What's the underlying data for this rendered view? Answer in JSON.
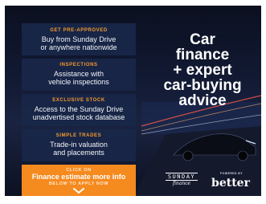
{
  "panels": [
    {
      "kicker": "GET PRE-APPROVED",
      "line1": "Buy from Sunday Drive",
      "line2": "or anywhere nationwide"
    },
    {
      "kicker": "INSPECTIONS",
      "line1": "Assistance with",
      "line2": "vehicle inspections"
    },
    {
      "kicker": "EXCLUSIVE STOCK",
      "line1": "Access to the Sunday Drive",
      "line2": "unadvertised stock database"
    },
    {
      "kicker": "SIMPLE TRADES",
      "line1": "Trade-in valuation",
      "line2": "and placements"
    }
  ],
  "cta": {
    "top": "CLICK ON",
    "main": "Finance estimate more info",
    "bottom": "BELOW TO APPLY NOW"
  },
  "headline": {
    "l1": "Car",
    "l2": "finance",
    "l3": "+ expert",
    "l4": "car-buying",
    "l5": "advice"
  },
  "brand": {
    "sunday_word": "SUNDAY",
    "sunday_script": "finance",
    "powered_by": "POWERED BY",
    "partner": "better"
  },
  "colors": {
    "accent": "#f58a1f",
    "panel": "#182648",
    "kicker": "#f59b2e"
  },
  "icons": {
    "cta_arrow": "chevron-down-icon"
  }
}
